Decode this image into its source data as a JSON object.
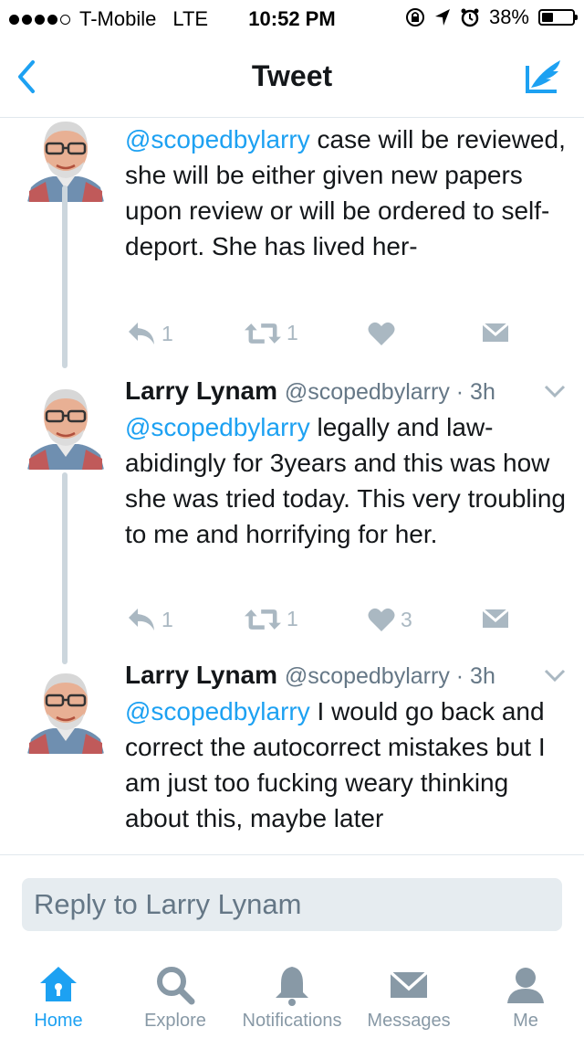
{
  "status_bar": {
    "carrier": "T-Mobile",
    "network": "LTE",
    "time": "10:52 PM",
    "battery": "38%",
    "signal_bars_filled": 4,
    "signal_bars_total": 5,
    "battery_level": 0.38
  },
  "nav": {
    "title": "Tweet",
    "back_icon": "chevron-left-icon",
    "compose_icon": "compose-tweet-icon"
  },
  "tweets": [
    {
      "mention": "@scopedbylarry",
      "text": " case will be reviewed, she will be either given new papers upon review or will be ordered to self-deport. She has lived her-",
      "replies": "1",
      "retweets": "1",
      "likes": ""
    },
    {
      "name": "Larry Lynam",
      "handle": "@scopedbylarry · 3h",
      "mention": "@scopedbylarry",
      "text": " legally and law-abidingly for 3years and this was how she was tried today. This very troubling to me and horrifying for her.",
      "replies": "1",
      "retweets": "1",
      "likes": "3"
    },
    {
      "name": "Larry Lynam",
      "handle": "@scopedbylarry · 3h",
      "mention": "@scopedbylarry",
      "text": " I would go back and correct the autocorrect mistakes but I am just too fucking weary thinking about this, maybe later"
    }
  ],
  "reply": {
    "placeholder": "Reply to Larry Lynam"
  },
  "tabs": [
    {
      "label": "Home",
      "icon": "home-icon",
      "active": true
    },
    {
      "label": "Explore",
      "icon": "search-icon",
      "active": false
    },
    {
      "label": "Notifications",
      "icon": "bell-icon",
      "active": false
    },
    {
      "label": "Messages",
      "icon": "envelope-icon",
      "active": false
    },
    {
      "label": "Me",
      "icon": "person-icon",
      "active": false
    }
  ],
  "colors": {
    "accent": "#1da1f2",
    "icon_gray": "#aab8c2",
    "thread_line": "#ccd6dd",
    "reply_box": "#e6ecf0",
    "tab_inactive": "#8899a6"
  }
}
